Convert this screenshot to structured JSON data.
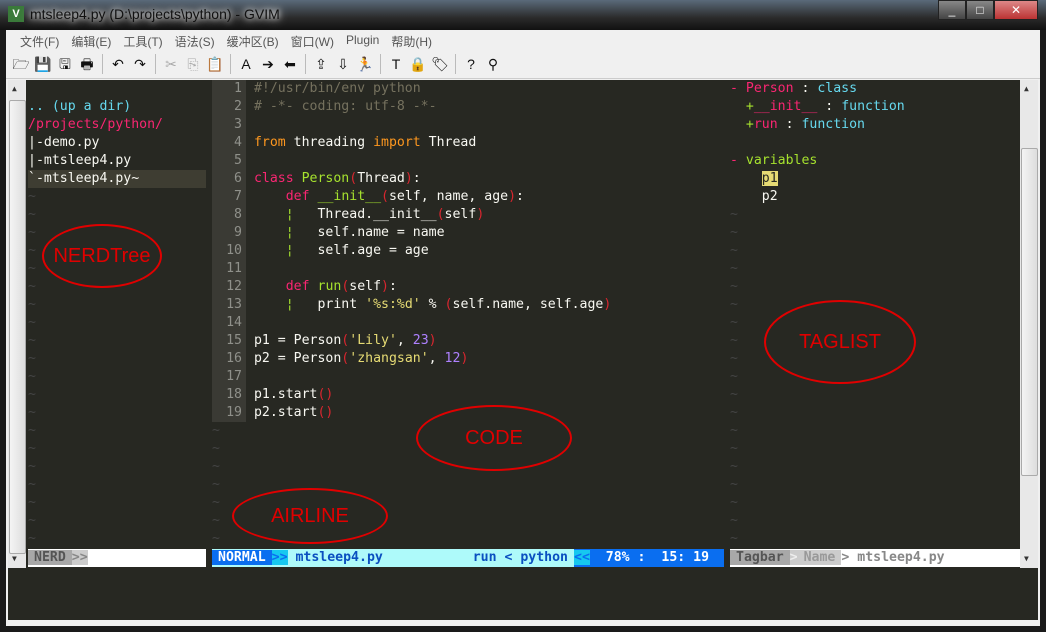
{
  "window": {
    "title": "mtsleep4.py (D:\\projects\\python) - GVIM",
    "icon": "vim-icon",
    "buttons": [
      "minimize",
      "maximize",
      "close"
    ]
  },
  "menu": [
    "文件(F)",
    "编辑(E)",
    "工具(T)",
    "语法(S)",
    "缓冲区(B)",
    "窗口(W)",
    "Plugin",
    "帮助(H)"
  ],
  "toolbar": [
    {
      "name": "open-icon",
      "g": "🗁"
    },
    {
      "name": "save-icon",
      "g": "💾"
    },
    {
      "name": "save-all-icon",
      "g": "🖫"
    },
    {
      "name": "print-icon",
      "g": "🖶"
    },
    "sep",
    {
      "name": "undo-icon",
      "g": "↶"
    },
    {
      "name": "redo-icon",
      "g": "↷"
    },
    "sep",
    {
      "name": "cut-icon",
      "g": "✂",
      "dim": true
    },
    {
      "name": "copy-icon",
      "g": "⎘",
      "dim": true
    },
    {
      "name": "paste-icon",
      "g": "📋"
    },
    "sep",
    {
      "name": "replace-icon",
      "g": "A"
    },
    {
      "name": "find-next-icon",
      "g": "➔"
    },
    {
      "name": "find-prev-icon",
      "g": "⬅"
    },
    "sep",
    {
      "name": "load-session-icon",
      "g": "⇪"
    },
    {
      "name": "save-session-icon",
      "g": "⇩"
    },
    {
      "name": "run-script-icon",
      "g": "🏃"
    },
    "sep",
    {
      "name": "make-icon",
      "g": "T"
    },
    {
      "name": "shell-icon",
      "g": "🔒"
    },
    {
      "name": "tags-icon",
      "g": "🏷"
    },
    "sep",
    {
      "name": "help-icon",
      "g": "?"
    },
    {
      "name": "find-help-icon",
      "g": "⚲"
    }
  ],
  "nerdtree": {
    "lines": [
      [
        "",
        ""
      ],
      [
        ".. (up a dir)",
        "b"
      ],
      [
        "/projects/python/",
        "k"
      ],
      [
        "|-demo.py",
        "w"
      ],
      [
        "|-mtsleep4.py",
        "w"
      ],
      [
        "`-mtsleep4.py~",
        "w"
      ]
    ]
  },
  "code": [
    [
      [
        "#!/usr/bin/env python",
        "c"
      ]
    ],
    [
      [
        "# -*- coding: utf-8 -*-",
        "c"
      ]
    ],
    [],
    [
      [
        "from",
        "o"
      ],
      [
        " threading ",
        "w"
      ],
      [
        "import",
        "o"
      ],
      [
        " Thread",
        "w"
      ]
    ],
    [],
    [
      [
        "class",
        "k"
      ],
      [
        " ",
        "w"
      ],
      [
        "Person",
        "g"
      ],
      [
        "(",
        "p"
      ],
      [
        "Thread",
        "w"
      ],
      [
        ")",
        "p"
      ],
      [
        ":",
        "w"
      ]
    ],
    [
      [
        "    ",
        "w"
      ],
      [
        "def",
        "k"
      ],
      [
        " ",
        "w"
      ],
      [
        "__init__",
        "g"
      ],
      [
        "(",
        "p"
      ],
      [
        "self, name, age",
        "w"
      ],
      [
        ")",
        "p"
      ],
      [
        ":",
        "w"
      ]
    ],
    [
      [
        "    ",
        "w"
      ],
      [
        "¦",
        "g"
      ],
      [
        "   Thread.__init__",
        "w"
      ],
      [
        "(",
        "p"
      ],
      [
        "self",
        "w"
      ],
      [
        ")",
        "p"
      ]
    ],
    [
      [
        "    ",
        "w"
      ],
      [
        "¦",
        "g"
      ],
      [
        "   self.name = name",
        "w"
      ]
    ],
    [
      [
        "    ",
        "w"
      ],
      [
        "¦",
        "g"
      ],
      [
        "   self.age = age",
        "w"
      ]
    ],
    [],
    [
      [
        "    ",
        "w"
      ],
      [
        "def",
        "k"
      ],
      [
        " ",
        "w"
      ],
      [
        "run",
        "g"
      ],
      [
        "(",
        "p"
      ],
      [
        "self",
        "w"
      ],
      [
        ")",
        "p"
      ],
      [
        ":",
        "w"
      ]
    ],
    [
      [
        "    ",
        "w"
      ],
      [
        "¦",
        "g"
      ],
      [
        "   print ",
        "w"
      ],
      [
        "'%s:%d'",
        "s"
      ],
      [
        " % ",
        "w"
      ],
      [
        "(",
        "p"
      ],
      [
        "self.name, self.age",
        "w"
      ],
      [
        ")",
        "p"
      ]
    ],
    [],
    [
      [
        "p1 = Person",
        "w"
      ],
      [
        "(",
        "p"
      ],
      [
        "'Lily'",
        "s"
      ],
      [
        ", ",
        "w"
      ],
      [
        "23",
        "n"
      ],
      [
        ")",
        "p"
      ]
    ],
    [
      [
        "p2 = Person",
        "w"
      ],
      [
        "(",
        "p"
      ],
      [
        "'zhangsan'",
        "s"
      ],
      [
        ", ",
        "w"
      ],
      [
        "12",
        "n"
      ],
      [
        ")",
        "p"
      ]
    ],
    [],
    [
      [
        "p1.start",
        "w"
      ],
      [
        "()",
        "p"
      ]
    ],
    [
      [
        "p2.start",
        "w"
      ],
      [
        "()",
        "p"
      ]
    ]
  ],
  "taglist": [
    [
      [
        "- ",
        "k"
      ],
      [
        "Person",
        "k"
      ],
      [
        " : ",
        "w"
      ],
      [
        "class",
        "b"
      ]
    ],
    [
      [
        "  +",
        "g"
      ],
      [
        "__init__",
        "k"
      ],
      [
        " : ",
        "w"
      ],
      [
        "function",
        "b"
      ]
    ],
    [
      [
        "  +",
        "g"
      ],
      [
        "run",
        "k"
      ],
      [
        " : ",
        "w"
      ],
      [
        "function",
        "b"
      ]
    ],
    [],
    [
      [
        "- ",
        "k"
      ],
      [
        "variables",
        "g"
      ]
    ],
    [
      [
        "    ",
        "w"
      ],
      [
        "p1",
        "hl"
      ]
    ],
    [
      [
        "    ",
        "w"
      ],
      [
        "p2",
        "w"
      ]
    ]
  ],
  "statusline": {
    "nerd": "NERD",
    "mode": "NORMAL",
    "file": "mtsleep4.py",
    "tag": "run < python",
    "percent": "78%",
    "pos": "15: 19",
    "tagbar": "Tagbar",
    "tagbar_sort": "Name",
    "tagbar_file": "mtsleep4.py"
  },
  "annotations": {
    "nerdtree": "NERDTree",
    "taglist": "TAGLIST",
    "code": "CODE",
    "airline": "AIRLINE"
  },
  "colors": {
    "bg": "#272822",
    "keyword": "#f92672",
    "string": "#e6db74",
    "function": "#a6e22e",
    "airline_mode": "#0a6ef0",
    "airline_file": "#aefafa"
  }
}
